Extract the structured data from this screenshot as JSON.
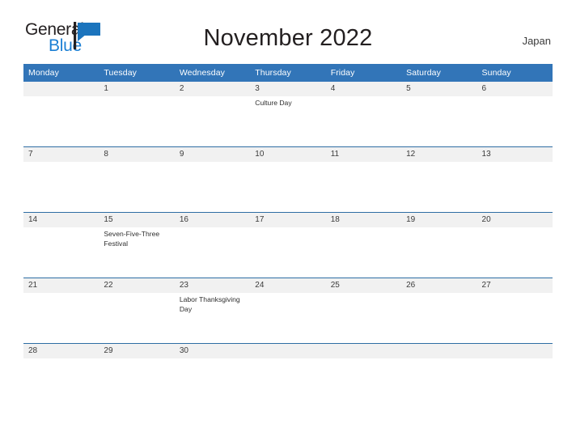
{
  "brand": {
    "name_part1": "General",
    "name_part2": "Blue",
    "flag_icon": "flag-icon",
    "accent_color": "#1b7fd4"
  },
  "header": {
    "title": "November 2022",
    "country": "Japan"
  },
  "theme": {
    "header_blue": "#3275b8",
    "row_divider_blue": "#2e6da4",
    "date_band_gray": "#f1f1f1",
    "text_dark": "#231f20"
  },
  "calendar": {
    "weekday_headers": [
      "Monday",
      "Tuesday",
      "Wednesday",
      "Thursday",
      "Friday",
      "Saturday",
      "Sunday"
    ],
    "weeks": [
      [
        {
          "date": "",
          "events": []
        },
        {
          "date": "1",
          "events": []
        },
        {
          "date": "2",
          "events": []
        },
        {
          "date": "3",
          "events": [
            "Culture Day"
          ]
        },
        {
          "date": "4",
          "events": []
        },
        {
          "date": "5",
          "events": []
        },
        {
          "date": "6",
          "events": []
        }
      ],
      [
        {
          "date": "7",
          "events": []
        },
        {
          "date": "8",
          "events": []
        },
        {
          "date": "9",
          "events": []
        },
        {
          "date": "10",
          "events": []
        },
        {
          "date": "11",
          "events": []
        },
        {
          "date": "12",
          "events": []
        },
        {
          "date": "13",
          "events": []
        }
      ],
      [
        {
          "date": "14",
          "events": []
        },
        {
          "date": "15",
          "events": [
            "Seven-Five-Three Festival"
          ]
        },
        {
          "date": "16",
          "events": []
        },
        {
          "date": "17",
          "events": []
        },
        {
          "date": "18",
          "events": []
        },
        {
          "date": "19",
          "events": []
        },
        {
          "date": "20",
          "events": []
        }
      ],
      [
        {
          "date": "21",
          "events": []
        },
        {
          "date": "22",
          "events": []
        },
        {
          "date": "23",
          "events": [
            "Labor Thanksgiving Day"
          ]
        },
        {
          "date": "24",
          "events": []
        },
        {
          "date": "25",
          "events": []
        },
        {
          "date": "26",
          "events": []
        },
        {
          "date": "27",
          "events": []
        }
      ],
      [
        {
          "date": "28",
          "events": []
        },
        {
          "date": "29",
          "events": []
        },
        {
          "date": "30",
          "events": []
        },
        {
          "date": "",
          "events": []
        },
        {
          "date": "",
          "events": []
        },
        {
          "date": "",
          "events": []
        },
        {
          "date": "",
          "events": []
        }
      ]
    ]
  }
}
